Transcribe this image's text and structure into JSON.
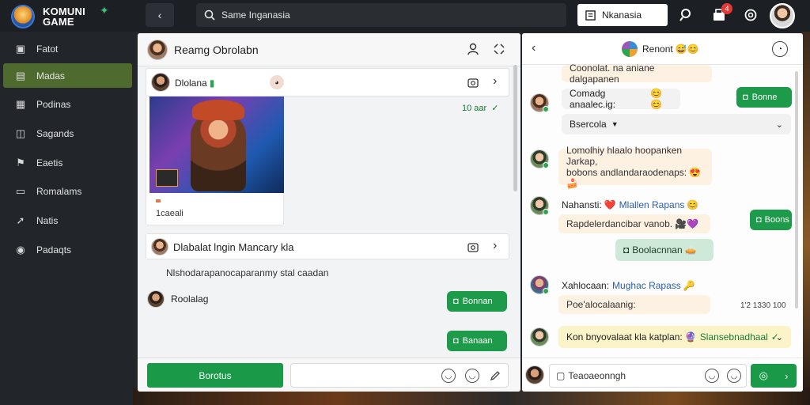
{
  "app": {
    "logo_line1": "KOMUNI",
    "logo_line2": "GAME"
  },
  "topbar": {
    "search_text": "Same Inganasia",
    "search2_text": "Nkanasia",
    "notification_count": "4"
  },
  "sidebar": {
    "items": [
      {
        "label": "Fatot",
        "icon": "layout-icon"
      },
      {
        "label": "Madas",
        "icon": "chat-icon"
      },
      {
        "label": "Podinas",
        "icon": "grid-icon"
      },
      {
        "label": "Sagands",
        "icon": "box-icon"
      },
      {
        "label": "Eaetis",
        "icon": "flag-icon"
      },
      {
        "label": "Romalams",
        "icon": "folder-icon"
      },
      {
        "label": "Natis",
        "icon": "pin-icon"
      },
      {
        "label": "Padaqts",
        "icon": "pin-icon"
      }
    ]
  },
  "mid": {
    "header_title": "Reamg Obrolabn",
    "card1_name": "Dlolana",
    "card1_time": "10 aar",
    "card1_caption": "1caeali",
    "card2_title": "Dlabalat lngin Mancary kla",
    "notice": "Nlshodarapanocaparanmy stal caadan",
    "user_name": "Roolalag",
    "bubble1": "Bonnan",
    "bubble2": "Banaan",
    "footer_button": "Borotus"
  },
  "right": {
    "header_title": "Renont",
    "msgs": {
      "m0": "Coonolat. na aniane dalgapanen",
      "m1": "Comadg anaalec.ig:",
      "m1_btn": "Bonne",
      "m2": "Bsercola",
      "m3_line1": "Lomolhiy hlaalo hoopanken Jarkap,",
      "m3_line2": "bobons andlandaraodenaps:",
      "m4_name": "Nahansti:",
      "m4_link": "Mlallen Rapans",
      "m4_line2": "Rapdelerdancibar vanob.",
      "m4_btn": "Boons",
      "m5": "Boolacnnan",
      "m6_name": "Xahlocaan:",
      "m6_link": "Mughac Rapass",
      "m6_line2": "Poe'alocalaanig:",
      "m6_time": "1'2 1330 100",
      "m7_text": "Kon bnyovalaat kla katplan:",
      "m7_link": "Slansebnadhaal"
    },
    "input_placeholder": "Teaoaeonngh"
  },
  "colors": {
    "accent_green": "#1a9a48",
    "sidebar_active": "#4e6a2e",
    "topbar_bg": "#1c1f23"
  }
}
